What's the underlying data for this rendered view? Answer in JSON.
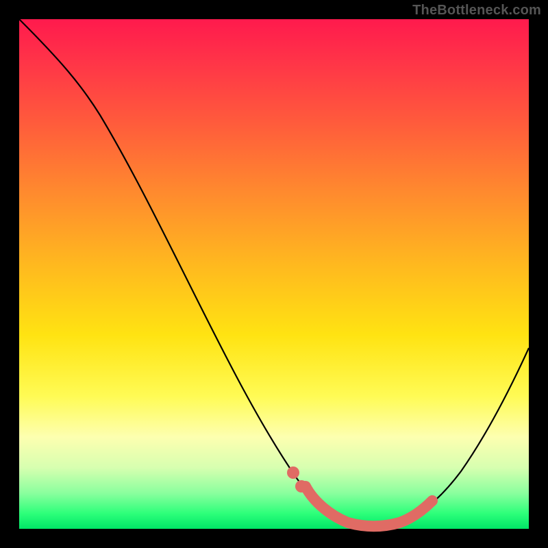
{
  "watermark": "TheBottleneck.com",
  "colors": {
    "frame": "#000000",
    "curve": "#000000",
    "highlight": "#e06b64",
    "gradient_stops": [
      "#ff1a4d",
      "#ff5a3c",
      "#ffb81f",
      "#ffe312",
      "#fdffb0",
      "#8aff9e",
      "#00e566"
    ]
  },
  "chart_data": {
    "type": "line",
    "title": "",
    "xlabel": "",
    "ylabel": "",
    "xlim": [
      0,
      100
    ],
    "ylim": [
      0,
      100
    ],
    "annotations": [],
    "series": [
      {
        "name": "bottleneck-curve",
        "x": [
          0,
          5,
          10,
          15,
          20,
          25,
          30,
          35,
          40,
          45,
          50,
          55,
          58,
          60,
          63,
          66,
          69,
          72,
          75,
          78,
          82,
          86,
          90,
          94,
          100
        ],
        "y": [
          100,
          94,
          87,
          80,
          72,
          64,
          55,
          46,
          37,
          28,
          20,
          12,
          8,
          5,
          2,
          1,
          0.5,
          0.5,
          1,
          2,
          5,
          10,
          18,
          28,
          45
        ]
      },
      {
        "name": "highlight-segment",
        "x": [
          55,
          58,
          60,
          63,
          66,
          69,
          72,
          75,
          78,
          80
        ],
        "y": [
          12,
          8,
          5,
          2,
          1,
          0.5,
          0.5,
          1,
          2,
          4
        ]
      }
    ]
  }
}
